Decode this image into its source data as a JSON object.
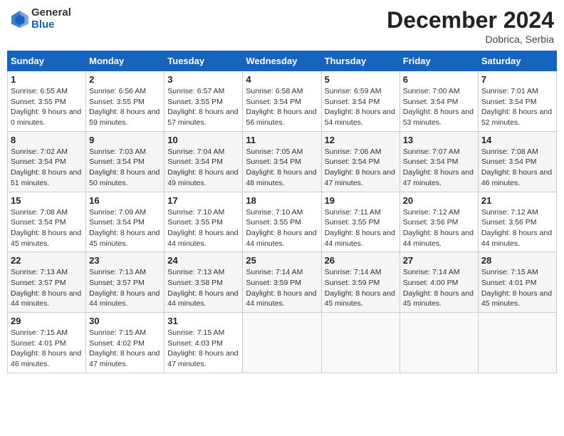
{
  "logo": {
    "general": "General",
    "blue": "Blue"
  },
  "header": {
    "month": "December 2024",
    "location": "Dobrica, Serbia"
  },
  "weekdays": [
    "Sunday",
    "Monday",
    "Tuesday",
    "Wednesday",
    "Thursday",
    "Friday",
    "Saturday"
  ],
  "weeks": [
    [
      {
        "day": "1",
        "sunrise": "6:55 AM",
        "sunset": "3:55 PM",
        "daylight": "9 hours and 0 minutes."
      },
      {
        "day": "2",
        "sunrise": "6:56 AM",
        "sunset": "3:55 PM",
        "daylight": "8 hours and 59 minutes."
      },
      {
        "day": "3",
        "sunrise": "6:57 AM",
        "sunset": "3:55 PM",
        "daylight": "8 hours and 57 minutes."
      },
      {
        "day": "4",
        "sunrise": "6:58 AM",
        "sunset": "3:54 PM",
        "daylight": "8 hours and 56 minutes."
      },
      {
        "day": "5",
        "sunrise": "6:59 AM",
        "sunset": "3:54 PM",
        "daylight": "8 hours and 54 minutes."
      },
      {
        "day": "6",
        "sunrise": "7:00 AM",
        "sunset": "3:54 PM",
        "daylight": "8 hours and 53 minutes."
      },
      {
        "day": "7",
        "sunrise": "7:01 AM",
        "sunset": "3:54 PM",
        "daylight": "8 hours and 52 minutes."
      }
    ],
    [
      {
        "day": "8",
        "sunrise": "7:02 AM",
        "sunset": "3:54 PM",
        "daylight": "8 hours and 51 minutes."
      },
      {
        "day": "9",
        "sunrise": "7:03 AM",
        "sunset": "3:54 PM",
        "daylight": "8 hours and 50 minutes."
      },
      {
        "day": "10",
        "sunrise": "7:04 AM",
        "sunset": "3:54 PM",
        "daylight": "8 hours and 49 minutes."
      },
      {
        "day": "11",
        "sunrise": "7:05 AM",
        "sunset": "3:54 PM",
        "daylight": "8 hours and 48 minutes."
      },
      {
        "day": "12",
        "sunrise": "7:06 AM",
        "sunset": "3:54 PM",
        "daylight": "8 hours and 47 minutes."
      },
      {
        "day": "13",
        "sunrise": "7:07 AM",
        "sunset": "3:54 PM",
        "daylight": "8 hours and 47 minutes."
      },
      {
        "day": "14",
        "sunrise": "7:08 AM",
        "sunset": "3:54 PM",
        "daylight": "8 hours and 46 minutes."
      }
    ],
    [
      {
        "day": "15",
        "sunrise": "7:08 AM",
        "sunset": "3:54 PM",
        "daylight": "8 hours and 45 minutes."
      },
      {
        "day": "16",
        "sunrise": "7:09 AM",
        "sunset": "3:54 PM",
        "daylight": "8 hours and 45 minutes."
      },
      {
        "day": "17",
        "sunrise": "7:10 AM",
        "sunset": "3:55 PM",
        "daylight": "8 hours and 44 minutes."
      },
      {
        "day": "18",
        "sunrise": "7:10 AM",
        "sunset": "3:55 PM",
        "daylight": "8 hours and 44 minutes."
      },
      {
        "day": "19",
        "sunrise": "7:11 AM",
        "sunset": "3:55 PM",
        "daylight": "8 hours and 44 minutes."
      },
      {
        "day": "20",
        "sunrise": "7:12 AM",
        "sunset": "3:56 PM",
        "daylight": "8 hours and 44 minutes."
      },
      {
        "day": "21",
        "sunrise": "7:12 AM",
        "sunset": "3:56 PM",
        "daylight": "8 hours and 44 minutes."
      }
    ],
    [
      {
        "day": "22",
        "sunrise": "7:13 AM",
        "sunset": "3:57 PM",
        "daylight": "8 hours and 44 minutes."
      },
      {
        "day": "23",
        "sunrise": "7:13 AM",
        "sunset": "3:57 PM",
        "daylight": "8 hours and 44 minutes."
      },
      {
        "day": "24",
        "sunrise": "7:13 AM",
        "sunset": "3:58 PM",
        "daylight": "8 hours and 44 minutes."
      },
      {
        "day": "25",
        "sunrise": "7:14 AM",
        "sunset": "3:59 PM",
        "daylight": "8 hours and 44 minutes."
      },
      {
        "day": "26",
        "sunrise": "7:14 AM",
        "sunset": "3:59 PM",
        "daylight": "8 hours and 45 minutes."
      },
      {
        "day": "27",
        "sunrise": "7:14 AM",
        "sunset": "4:00 PM",
        "daylight": "8 hours and 45 minutes."
      },
      {
        "day": "28",
        "sunrise": "7:15 AM",
        "sunset": "4:01 PM",
        "daylight": "8 hours and 45 minutes."
      }
    ],
    [
      {
        "day": "29",
        "sunrise": "7:15 AM",
        "sunset": "4:01 PM",
        "daylight": "8 hours and 46 minutes."
      },
      {
        "day": "30",
        "sunrise": "7:15 AM",
        "sunset": "4:02 PM",
        "daylight": "8 hours and 47 minutes."
      },
      {
        "day": "31",
        "sunrise": "7:15 AM",
        "sunset": "4:03 PM",
        "daylight": "8 hours and 47 minutes."
      },
      null,
      null,
      null,
      null
    ]
  ],
  "labels": {
    "sunrise": "Sunrise:",
    "sunset": "Sunset:",
    "daylight": "Daylight:"
  }
}
